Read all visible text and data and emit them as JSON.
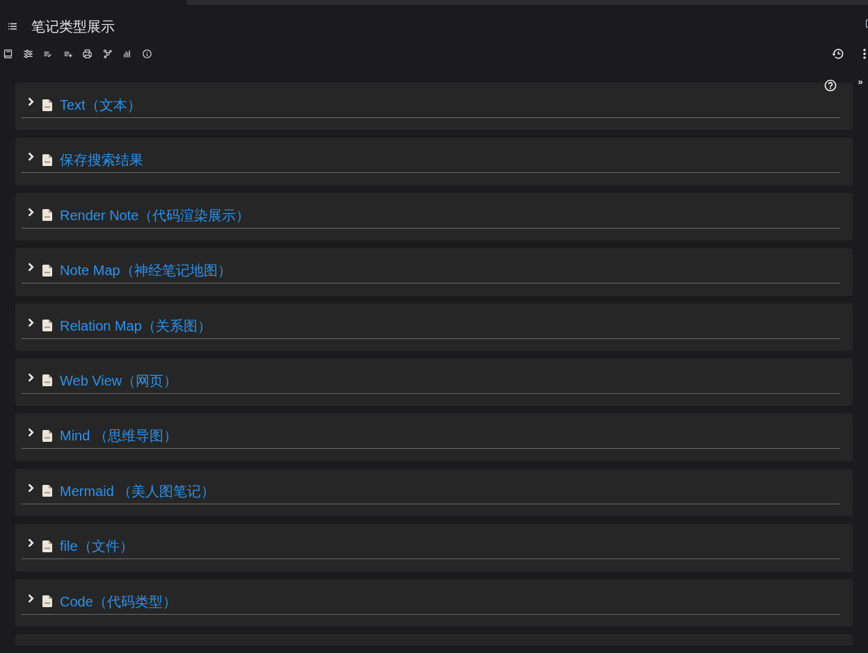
{
  "note": {
    "title": "笔记类型展示"
  },
  "right_pane": {
    "toggle": "»"
  },
  "children": [
    {
      "title": "Text（文本）",
      "expanded": false
    },
    {
      "title": "保存搜索结果",
      "expanded": false
    },
    {
      "title": "Render Note（代码渲染展示）",
      "expanded": false
    },
    {
      "title": "Note Map（神经笔记地图）",
      "expanded": false
    },
    {
      "title": "Relation Map（关系图）",
      "expanded": false
    },
    {
      "title": "Web View（网页）",
      "expanded": false
    },
    {
      "title": "Mind （思维导图）",
      "expanded": false
    },
    {
      "title": "Mermaid （美人图笔记）",
      "expanded": false
    },
    {
      "title": "file（文件）",
      "expanded": false
    },
    {
      "title": "Code（代码类型）",
      "expanded": false
    }
  ]
}
